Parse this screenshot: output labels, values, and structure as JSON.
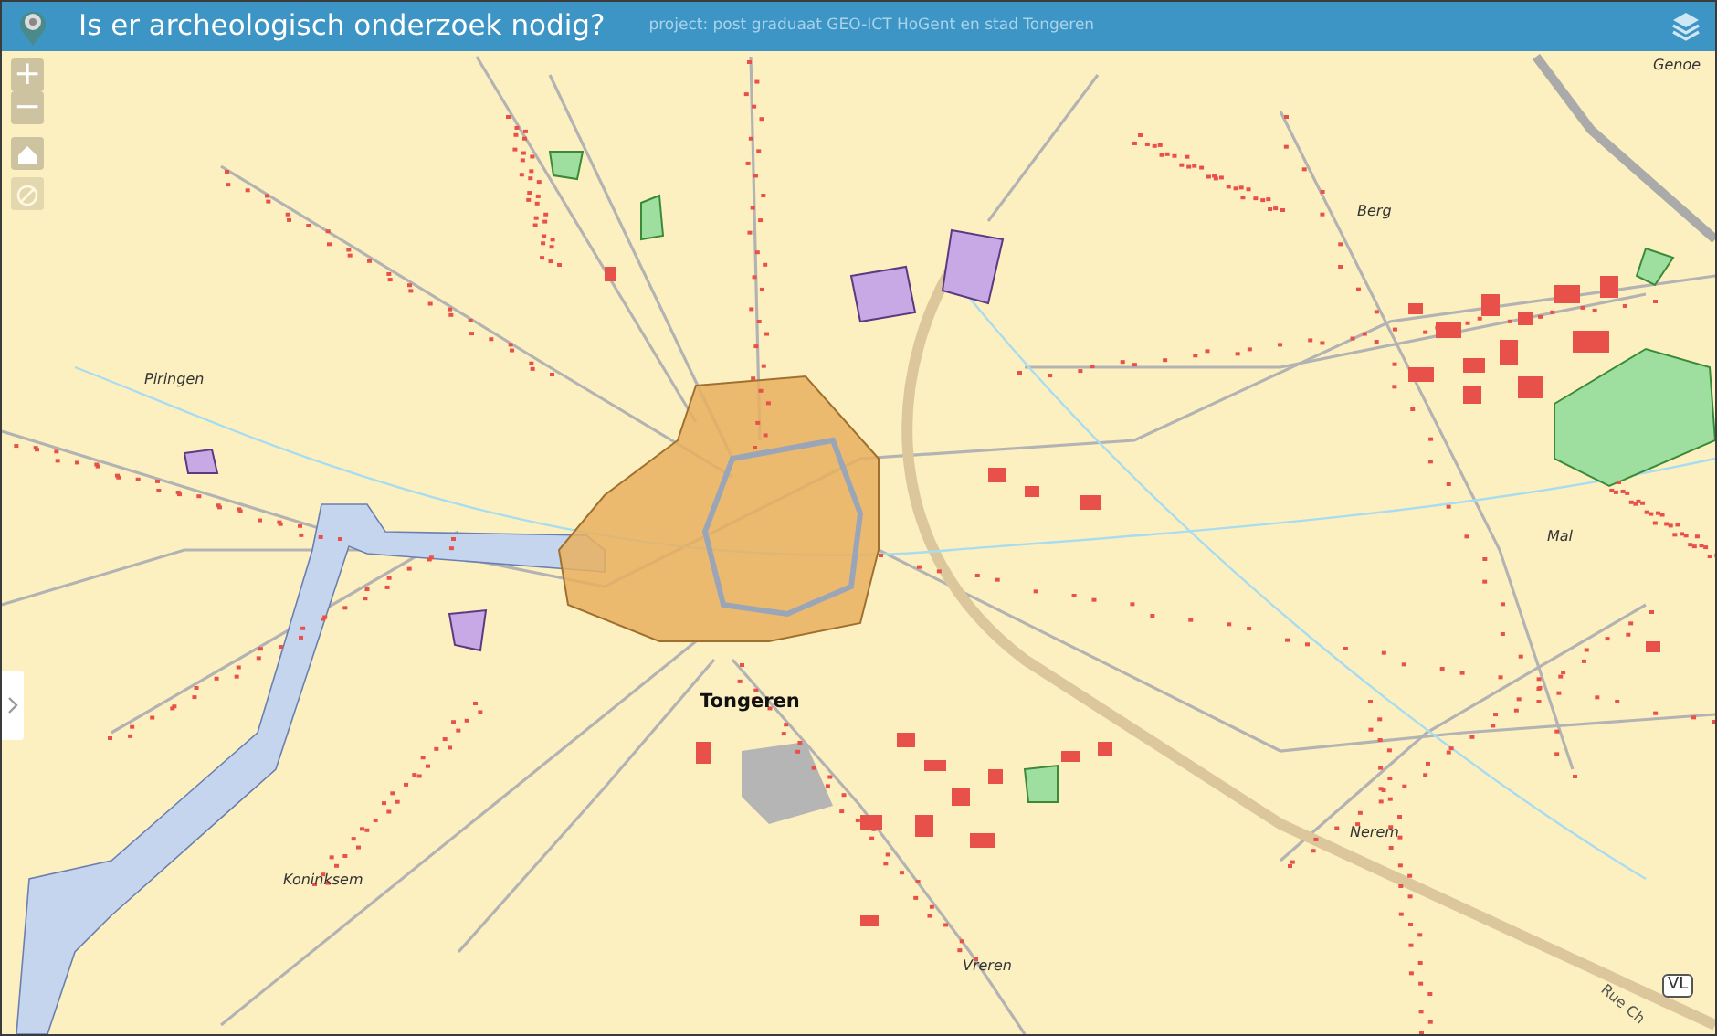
{
  "header": {
    "title": "Is er archeologisch onderzoek nodig?",
    "subtitle": "project: post graduaat GEO-ICT HoGent en stad Tongeren"
  },
  "map_controls": [
    {
      "kind": "zoom-in",
      "label": "+",
      "disabled": false
    },
    {
      "kind": "zoom-out",
      "label": "−",
      "disabled": false
    },
    {
      "kind": "home",
      "disabled": false
    },
    {
      "kind": "locate",
      "disabled": true
    }
  ],
  "map_labels": [
    {
      "kind": "village",
      "text": "Genoe"
    },
    {
      "kind": "village",
      "text": "Berg"
    },
    {
      "kind": "village",
      "text": "Piringen"
    },
    {
      "kind": "city",
      "text": "Tongeren"
    },
    {
      "kind": "village",
      "text": "Mal"
    },
    {
      "kind": "village",
      "text": "Koninksem"
    },
    {
      "kind": "village",
      "text": "Nerem"
    },
    {
      "kind": "village",
      "text": "Vreren"
    },
    {
      "kind": "street",
      "text": "Rue Ch"
    },
    {
      "kind": "shield",
      "text": "VL"
    }
  ]
}
